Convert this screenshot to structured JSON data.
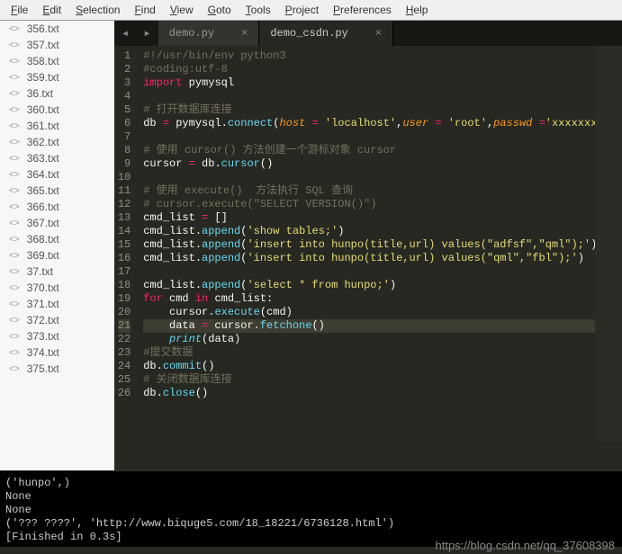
{
  "menu": {
    "items": [
      "File",
      "Edit",
      "Selection",
      "Find",
      "View",
      "Goto",
      "Tools",
      "Project",
      "Preferences",
      "Help"
    ]
  },
  "sidebar": {
    "files": [
      "356.txt",
      "357.txt",
      "358.txt",
      "359.txt",
      "36.txt",
      "360.txt",
      "361.txt",
      "362.txt",
      "363.txt",
      "364.txt",
      "365.txt",
      "366.txt",
      "367.txt",
      "368.txt",
      "369.txt",
      "37.txt",
      "370.txt",
      "371.txt",
      "372.txt",
      "373.txt",
      "374.txt",
      "375.txt"
    ]
  },
  "tabs": {
    "inactive": "demo.py",
    "active": "demo_csdn.py"
  },
  "code": {
    "lines": [
      {
        "n": 1,
        "seg": [
          {
            "t": "#!/usr/bin/env python3",
            "c": "c-comment"
          }
        ]
      },
      {
        "n": 2,
        "seg": [
          {
            "t": "#coding:utf-8",
            "c": "c-comment"
          }
        ]
      },
      {
        "n": 3,
        "seg": [
          {
            "t": "import",
            "c": "c-kw"
          },
          {
            "t": " pymysql",
            "c": "c-name"
          }
        ]
      },
      {
        "n": 4,
        "seg": []
      },
      {
        "n": 5,
        "seg": [
          {
            "t": "# 打开数据库连接",
            "c": "c-comment"
          }
        ]
      },
      {
        "n": 6,
        "seg": [
          {
            "t": "db ",
            "c": "c-name"
          },
          {
            "t": "=",
            "c": "c-op"
          },
          {
            "t": " pymysql.",
            "c": "c-name"
          },
          {
            "t": "connect",
            "c": "c-funcc"
          },
          {
            "t": "(",
            "c": "c-name"
          },
          {
            "t": "host",
            "c": "c-param"
          },
          {
            "t": " ",
            "c": "c-name"
          },
          {
            "t": "=",
            "c": "c-op"
          },
          {
            "t": " ",
            "c": "c-name"
          },
          {
            "t": "'localhost'",
            "c": "c-str"
          },
          {
            "t": ",",
            "c": "c-name"
          },
          {
            "t": "user",
            "c": "c-param"
          },
          {
            "t": " ",
            "c": "c-name"
          },
          {
            "t": "=",
            "c": "c-op"
          },
          {
            "t": " ",
            "c": "c-name"
          },
          {
            "t": "'root'",
            "c": "c-str"
          },
          {
            "t": ",",
            "c": "c-name"
          },
          {
            "t": "passwd",
            "c": "c-param"
          },
          {
            "t": " ",
            "c": "c-name"
          },
          {
            "t": "=",
            "c": "c-op"
          },
          {
            "t": "'xxxxxxxxx'",
            "c": "c-str"
          }
        ]
      },
      {
        "n": 7,
        "seg": []
      },
      {
        "n": 8,
        "seg": [
          {
            "t": "# 使用 cursor() 方法创建一个游标对象 cursor",
            "c": "c-comment"
          }
        ]
      },
      {
        "n": 9,
        "seg": [
          {
            "t": "cursor ",
            "c": "c-name"
          },
          {
            "t": "=",
            "c": "c-op"
          },
          {
            "t": " db.",
            "c": "c-name"
          },
          {
            "t": "cursor",
            "c": "c-funcc"
          },
          {
            "t": "()",
            "c": "c-name"
          }
        ]
      },
      {
        "n": 10,
        "seg": []
      },
      {
        "n": 11,
        "seg": [
          {
            "t": "# 使用 execute()  方法执行 SQL 查询",
            "c": "c-comment"
          }
        ]
      },
      {
        "n": 12,
        "seg": [
          {
            "t": "# cursor.execute(\"SELECT VERSION()\")",
            "c": "c-comment"
          }
        ]
      },
      {
        "n": 13,
        "seg": [
          {
            "t": "cmd_list ",
            "c": "c-name"
          },
          {
            "t": "=",
            "c": "c-op"
          },
          {
            "t": " []",
            "c": "c-name"
          }
        ]
      },
      {
        "n": 14,
        "seg": [
          {
            "t": "cmd_list.",
            "c": "c-name"
          },
          {
            "t": "append",
            "c": "c-funcc"
          },
          {
            "t": "(",
            "c": "c-name"
          },
          {
            "t": "'show tables;'",
            "c": "c-str"
          },
          {
            "t": ")",
            "c": "c-name"
          }
        ]
      },
      {
        "n": 15,
        "seg": [
          {
            "t": "cmd_list.",
            "c": "c-name"
          },
          {
            "t": "append",
            "c": "c-funcc"
          },
          {
            "t": "(",
            "c": "c-name"
          },
          {
            "t": "'insert into hunpo(title,url) values(\"adfsf\",\"qml\");'",
            "c": "c-str"
          },
          {
            "t": ")",
            "c": "c-name"
          }
        ]
      },
      {
        "n": 16,
        "seg": [
          {
            "t": "cmd_list.",
            "c": "c-name"
          },
          {
            "t": "append",
            "c": "c-funcc"
          },
          {
            "t": "(",
            "c": "c-name"
          },
          {
            "t": "'insert into hunpo(title,url) values(\"qml\",\"fbl\");'",
            "c": "c-str"
          },
          {
            "t": ")",
            "c": "c-name"
          }
        ]
      },
      {
        "n": 17,
        "seg": []
      },
      {
        "n": 18,
        "seg": [
          {
            "t": "cmd_list.",
            "c": "c-name"
          },
          {
            "t": "append",
            "c": "c-funcc"
          },
          {
            "t": "(",
            "c": "c-name"
          },
          {
            "t": "'select * from hunpo;'",
            "c": "c-str"
          },
          {
            "t": ")",
            "c": "c-name"
          }
        ]
      },
      {
        "n": 19,
        "seg": [
          {
            "t": "for",
            "c": "c-kw"
          },
          {
            "t": " cmd ",
            "c": "c-name"
          },
          {
            "t": "in",
            "c": "c-kw"
          },
          {
            "t": " cmd_list:",
            "c": "c-name"
          }
        ]
      },
      {
        "n": 20,
        "seg": [
          {
            "t": "    cursor.",
            "c": "c-name"
          },
          {
            "t": "execute",
            "c": "c-funcc"
          },
          {
            "t": "(cmd)",
            "c": "c-name"
          }
        ]
      },
      {
        "n": 21,
        "hl": true,
        "seg": [
          {
            "t": "    data ",
            "c": "c-name"
          },
          {
            "t": "=",
            "c": "c-op"
          },
          {
            "t": " cursor.",
            "c": "c-name"
          },
          {
            "t": "fetchone",
            "c": "c-funcc"
          },
          {
            "t": "()",
            "c": "c-name"
          }
        ]
      },
      {
        "n": 22,
        "seg": [
          {
            "t": "    ",
            "c": "c-name"
          },
          {
            "t": "print",
            "c": "c-builtin"
          },
          {
            "t": "(data)",
            "c": "c-name"
          }
        ]
      },
      {
        "n": 23,
        "seg": [
          {
            "t": "#提交数据",
            "c": "c-comment"
          }
        ]
      },
      {
        "n": 24,
        "seg": [
          {
            "t": "db.",
            "c": "c-name"
          },
          {
            "t": "commit",
            "c": "c-funcc"
          },
          {
            "t": "()",
            "c": "c-name"
          }
        ]
      },
      {
        "n": 25,
        "seg": [
          {
            "t": "# 关闭数据库连接",
            "c": "c-comment"
          }
        ]
      },
      {
        "n": 26,
        "seg": [
          {
            "t": "db.",
            "c": "c-name"
          },
          {
            "t": "close",
            "c": "c-funcc"
          },
          {
            "t": "()",
            "c": "c-name"
          }
        ]
      }
    ]
  },
  "console": {
    "lines": [
      "('hunpo',)",
      "None",
      "None",
      "('??? ????', 'http://www.biquge5.com/18_18221/6736128.html')",
      "[Finished in 0.3s]"
    ]
  },
  "watermark": "https://blog.csdn.net/qq_37608398"
}
